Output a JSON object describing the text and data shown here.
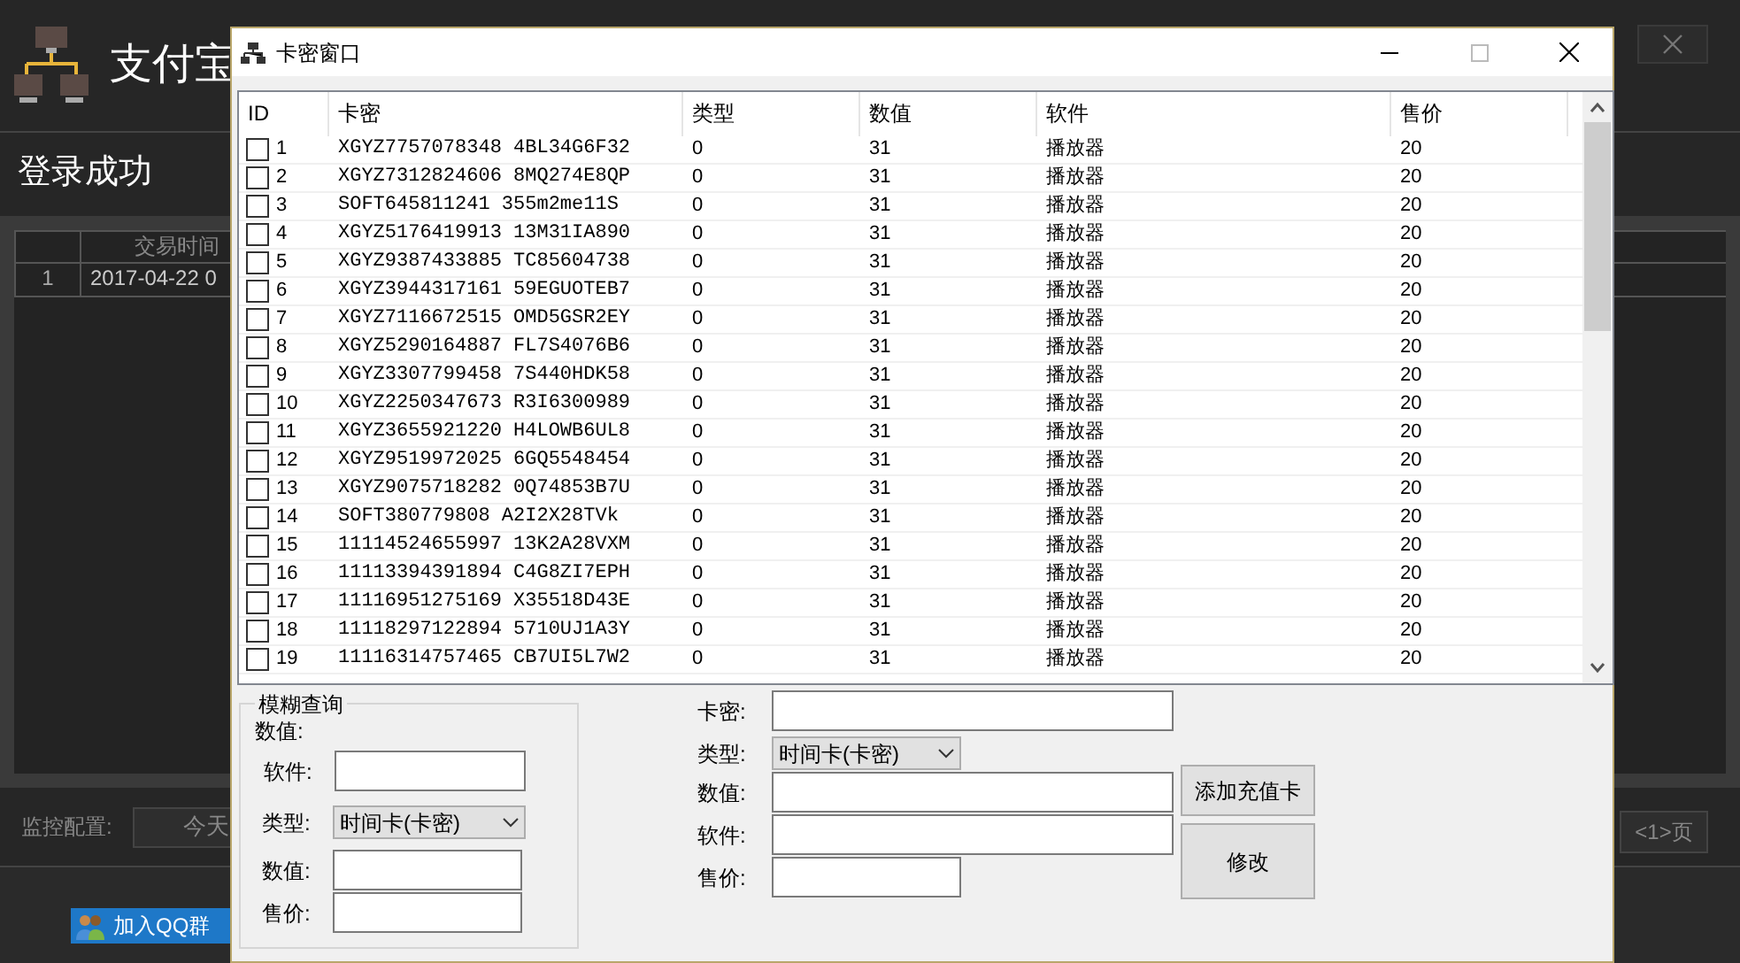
{
  "app": {
    "title": "支付宝",
    "status": "登录成功",
    "table": {
      "columns": [
        "",
        "交易时间"
      ],
      "rows": [
        {
          "index": "1",
          "time": "2017-04-22 0"
        }
      ]
    },
    "monitor_label": "监控配置:",
    "today_button": "今天",
    "page_button": "<1>页",
    "qq_button": "加入QQ群"
  },
  "dialog": {
    "title": "卡密窗口",
    "columns": [
      "ID",
      "卡密",
      "类型",
      "数值",
      "软件",
      "售价"
    ],
    "rows": [
      {
        "id": "1",
        "card": "XGYZ7757078348 4BL34G6F32",
        "type": "0",
        "value": "31",
        "software": "播放器",
        "price": "20",
        "checked": false
      },
      {
        "id": "2",
        "card": "XGYZ7312824606 8MQ274E8QP",
        "type": "0",
        "value": "31",
        "software": "播放器",
        "price": "20",
        "checked": false
      },
      {
        "id": "3",
        "card": "SOFT645811241 355m2me11S",
        "type": "0",
        "value": "31",
        "software": "播放器",
        "price": "20",
        "checked": false
      },
      {
        "id": "4",
        "card": "XGYZ5176419913 13M31IA890",
        "type": "0",
        "value": "31",
        "software": "播放器",
        "price": "20",
        "checked": false
      },
      {
        "id": "5",
        "card": "XGYZ9387433885 TC85604738",
        "type": "0",
        "value": "31",
        "software": "播放器",
        "price": "20",
        "checked": false
      },
      {
        "id": "6",
        "card": "XGYZ3944317161 59EGUOTEB7",
        "type": "0",
        "value": "31",
        "software": "播放器",
        "price": "20",
        "checked": false
      },
      {
        "id": "7",
        "card": "XGYZ7116672515 OMD5GSR2EY",
        "type": "0",
        "value": "31",
        "software": "播放器",
        "price": "20",
        "checked": false
      },
      {
        "id": "8",
        "card": "XGYZ5290164887 FL7S4076B6",
        "type": "0",
        "value": "31",
        "software": "播放器",
        "price": "20",
        "checked": false
      },
      {
        "id": "9",
        "card": "XGYZ3307799458 7S440HDK58",
        "type": "0",
        "value": "31",
        "software": "播放器",
        "price": "20",
        "checked": false
      },
      {
        "id": "10",
        "card": "XGYZ2250347673 R3I6300989",
        "type": "0",
        "value": "31",
        "software": "播放器",
        "price": "20",
        "checked": false
      },
      {
        "id": "11",
        "card": "XGYZ3655921220 H4LOWB6UL8",
        "type": "0",
        "value": "31",
        "software": "播放器",
        "price": "20",
        "checked": false
      },
      {
        "id": "12",
        "card": "XGYZ9519972025 6GQ5548454",
        "type": "0",
        "value": "31",
        "software": "播放器",
        "price": "20",
        "checked": false
      },
      {
        "id": "13",
        "card": "XGYZ9075718282 0Q74853B7U",
        "type": "0",
        "value": "31",
        "software": "播放器",
        "price": "20",
        "checked": false
      },
      {
        "id": "14",
        "card": "SOFT380779808 A2I2X28TVk",
        "type": "0",
        "value": "31",
        "software": "播放器",
        "price": "20",
        "checked": false
      },
      {
        "id": "15",
        "card": "11114524655997 13K2A28VXM",
        "type": "0",
        "value": "31",
        "software": "播放器",
        "price": "20",
        "checked": false
      },
      {
        "id": "16",
        "card": "11113394391894 C4G8ZI7EPH",
        "type": "0",
        "value": "31",
        "software": "播放器",
        "price": "20",
        "checked": false
      },
      {
        "id": "17",
        "card": "11116951275169 X35518D43E",
        "type": "0",
        "value": "31",
        "software": "播放器",
        "price": "20",
        "checked": false
      },
      {
        "id": "18",
        "card": "11118297122894 5710UJ1A3Y",
        "type": "0",
        "value": "31",
        "software": "播放器",
        "price": "20",
        "checked": false
      },
      {
        "id": "19",
        "card": "11116314757465 CB7UI5L7W2",
        "type": "0",
        "value": "31",
        "software": "播放器",
        "price": "20",
        "checked": false
      }
    ],
    "search_group": {
      "title": "模糊查询",
      "heading": "数值:",
      "software_label": "软件:",
      "type_label": "类型:",
      "type_value": "时间卡(卡密)",
      "value_label": "数值:",
      "price_label": "售价:"
    },
    "edit_form": {
      "card_label": "卡密:",
      "type_label": "类型:",
      "type_value": "时间卡(卡密)",
      "value_label": "数值:",
      "software_label": "软件:",
      "price_label": "售价:"
    },
    "add_button": "添加充值卡",
    "modify_button": "修改"
  }
}
